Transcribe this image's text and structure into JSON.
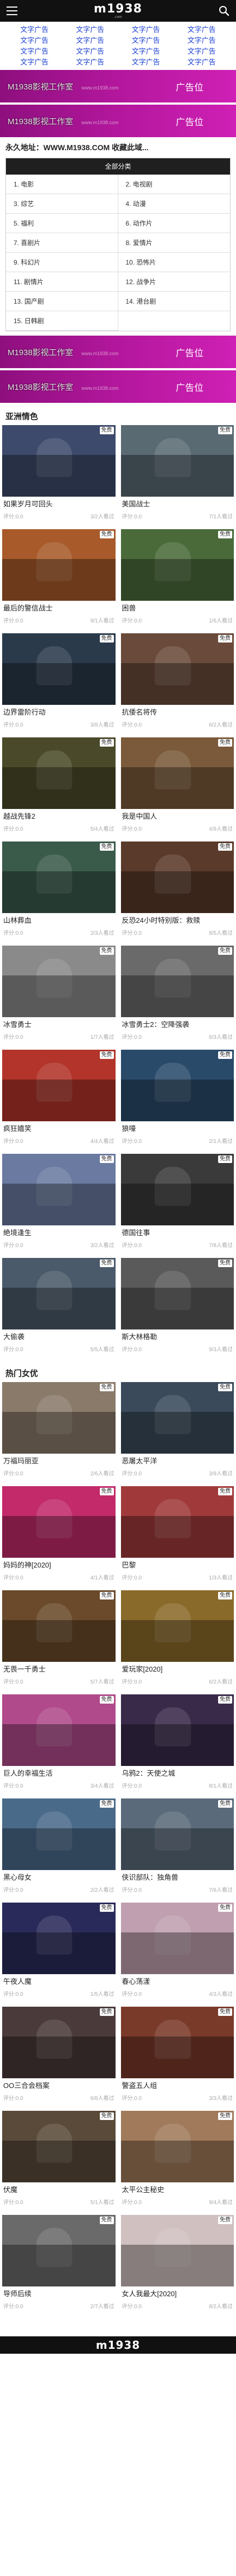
{
  "header": {
    "logo": "m1938",
    "logo_sub": ".com"
  },
  "text_ads": [
    "文字广告",
    "文字广告",
    "文字广告",
    "文字广告",
    "文字广告",
    "文字广告",
    "文字广告",
    "文字广告",
    "文字广告",
    "文字广告",
    "文字广告",
    "文字广告",
    "文字广告",
    "文字广告",
    "文字广告",
    "文字广告"
  ],
  "banner": {
    "left": "M1938影视工作室",
    "mid": "www.m1938.com",
    "right": "广告位"
  },
  "notice": "永久地址：WWW.M1938.COM 收藏此域...",
  "categories": {
    "heading": "全部分类",
    "items": [
      "1. 电影",
      "2. 电视剧",
      "3. 综艺",
      "4. 动漫",
      "5. 福利",
      "6. 动作片",
      "7. 喜剧片",
      "8. 爱情片",
      "9. 科幻片",
      "10. 恐怖片",
      "11. 剧情片",
      "12. 战争片",
      "13. 国产剧",
      "14. 港台剧",
      "15. 日韩剧"
    ]
  },
  "sections": [
    {
      "title": "亚洲情色",
      "movies": [
        {
          "title": "如果岁月可回头",
          "badge": "免费",
          "score": "评分:0.0",
          "views": "3/2人看过",
          "color": "#3d4a6b"
        },
        {
          "title": "美国战士",
          "badge": "免费",
          "score": "评分:0.0",
          "views": "7/1人看过",
          "color": "#5a6a73"
        },
        {
          "title": "最后的警信战士",
          "badge": "免费",
          "score": "评分:0.0",
          "views": "9/1人看过",
          "color": "#a85a2a"
        },
        {
          "title": "困兽",
          "badge": "免费",
          "score": "评分:0.0",
          "views": "1/6人看过",
          "color": "#4a6a3a"
        },
        {
          "title": "边界雷阶行动",
          "badge": "免费",
          "score": "评分:0.0",
          "views": "3/8人看过",
          "color": "#2a3a4a"
        },
        {
          "title": "抗倭名将传",
          "badge": "免费",
          "score": "评分:0.0",
          "views": "6/2人看过",
          "color": "#6a4a3a"
        },
        {
          "title": "越战先锋2",
          "badge": "免费",
          "score": "评分:0.0",
          "views": "5/4人看过",
          "color": "#4a4a2a"
        },
        {
          "title": "我是中国人",
          "badge": "免费",
          "score": "评分:0.0",
          "views": "4/9人看过",
          "color": "#7a5a3a"
        },
        {
          "title": "山林葬血",
          "badge": "免费",
          "score": "评分:0.0",
          "views": "2/3人看过",
          "color": "#3a5a4a"
        },
        {
          "title": "反恐24小时特别版：救赎",
          "badge": "免费",
          "score": "评分:0.0",
          "views": "8/5人看过",
          "color": "#5a3a2a"
        },
        {
          "title": "冰雪勇士",
          "badge": "免费",
          "score": "评分:0.0",
          "views": "1/7人看过",
          "color": "#8a8a8a"
        },
        {
          "title": "冰雪勇士2：空降强袭",
          "badge": "免费",
          "score": "评分:0.0",
          "views": "6/3人看过",
          "color": "#6a6a6a"
        },
        {
          "title": "疯狂嬉笑",
          "badge": "免费",
          "score": "评分:0.0",
          "views": "4/4人看过",
          "color": "#b2342a"
        },
        {
          "title": "狼嚎",
          "badge": "免费",
          "score": "评分:0.0",
          "views": "2/1人看过",
          "color": "#2a4a6a"
        },
        {
          "title": "絶境逢生",
          "badge": "免费",
          "score": "评分:0.0",
          "views": "3/2人看过",
          "color": "#6a7aa0"
        },
        {
          "title": "德国往事",
          "badge": "免费",
          "score": "评分:0.0",
          "views": "7/8人看过",
          "color": "#3a3a3a"
        },
        {
          "title": "大偷袭",
          "badge": "免费",
          "score": "评分:0.0",
          "views": "5/5人看过",
          "color": "#4a5a6a"
        },
        {
          "title": "斯大林格勒",
          "badge": "免费",
          "score": "评分:0.0",
          "views": "9/3人看过",
          "color": "#5a5a5a"
        }
      ]
    },
    {
      "title": "热门女优",
      "movies": [
        {
          "title": "万福玛丽亚",
          "badge": "免费",
          "score": "评分:0.0",
          "views": "2/6人看过",
          "color": "#8a7a6a"
        },
        {
          "title": "恶屠太平洋",
          "badge": "免费",
          "score": "评分:0.0",
          "views": "3/9人看过",
          "color": "#3a4a5a"
        },
        {
          "title": "妈妈的神[2020]",
          "badge": "免费",
          "score": "评分:0.0",
          "views": "4/1人看过",
          "color": "#c22a6a"
        },
        {
          "title": "巴黎",
          "badge": "免费",
          "score": "评分:0.0",
          "views": "1/3人看过",
          "color": "#a03a3a"
        },
        {
          "title": "无畏一千勇士",
          "badge": "免费",
          "score": "评分:0.0",
          "views": "5/7人看过",
          "color": "#6a4a2a"
        },
        {
          "title": "爱玩家[2020]",
          "badge": "免费",
          "score": "评分:0.0",
          "views": "6/2人看过",
          "color": "#8a6a2a"
        },
        {
          "title": "巨人的幸福生活",
          "badge": "免费",
          "score": "评分:0.0",
          "views": "3/4人看过",
          "color": "#b04a8a"
        },
        {
          "title": "乌鸦2：天使之城",
          "badge": "免费",
          "score": "评分:0.0",
          "views": "8/1人看过",
          "color": "#3a2a4a"
        },
        {
          "title": "黑心母女",
          "badge": "免费",
          "score": "评分:0.0",
          "views": "2/2人看过",
          "color": "#4a6a8a"
        },
        {
          "title": "侠识部队：独角兽",
          "badge": "免费",
          "score": "评分:0.0",
          "views": "7/6人看过",
          "color": "#5a6a7a"
        },
        {
          "title": "午夜人魔",
          "badge": "免费",
          "score": "评分:0.0",
          "views": "1/5人看过",
          "color": "#2a2a5a"
        },
        {
          "title": "春心荡漾",
          "badge": "免费",
          "score": "评分:0.0",
          "views": "4/3人看过",
          "color": "#c0a0b0"
        },
        {
          "title": "OO三合会档案",
          "badge": "免费",
          "score": "评分:0.0",
          "views": "6/8人看过",
          "color": "#4a3a3a"
        },
        {
          "title": "警盗五人组",
          "badge": "免费",
          "score": "评分:0.0",
          "views": "3/3人看过",
          "color": "#7a3a2a"
        },
        {
          "title": "伏魔",
          "badge": "免费",
          "score": "评分:0.0",
          "views": "5/1人看过",
          "color": "#5a4a3a"
        },
        {
          "title": "太平公主秘史",
          "badge": "免费",
          "score": "评分:0.0",
          "views": "9/4人看过",
          "color": "#a07a5a"
        },
        {
          "title": "导师后续",
          "badge": "免费",
          "score": "评分:0.0",
          "views": "2/7人看过",
          "color": "#6a6a6a"
        },
        {
          "title": "女人我最大[2020]",
          "badge": "免费",
          "score": "评分:0.0",
          "views": "8/2人看过",
          "color": "#d0c0c0"
        }
      ]
    }
  ],
  "footer": {
    "logo": "m1938"
  }
}
